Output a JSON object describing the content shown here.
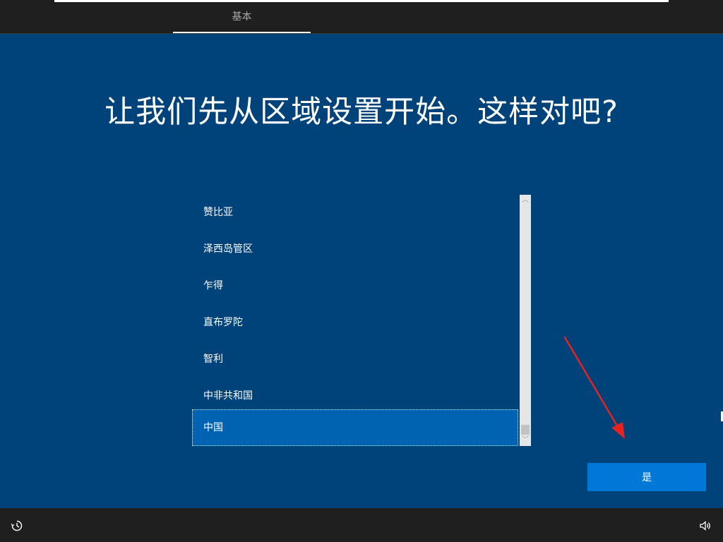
{
  "header": {
    "step_label": "基本"
  },
  "main": {
    "headline": "让我们先从区域设置开始。这样对吧?"
  },
  "region_list": {
    "items": [
      "赞比亚",
      "泽西岛管区",
      "乍得",
      "直布罗陀",
      "智利",
      "中非共和国",
      "中国"
    ],
    "selected": "中国",
    "scroll_up_glyph": "︿",
    "scroll_down_glyph": "﹀"
  },
  "actions": {
    "yes_label": "是"
  },
  "footer": {
    "left_icon": "ease-of-access-icon",
    "right_icon": "volume-icon"
  },
  "colors": {
    "background": "#00437a",
    "bars": "#1f1f1f",
    "selection": "#0063b1",
    "button": "#0078d7",
    "annotation": "#e8231f"
  }
}
